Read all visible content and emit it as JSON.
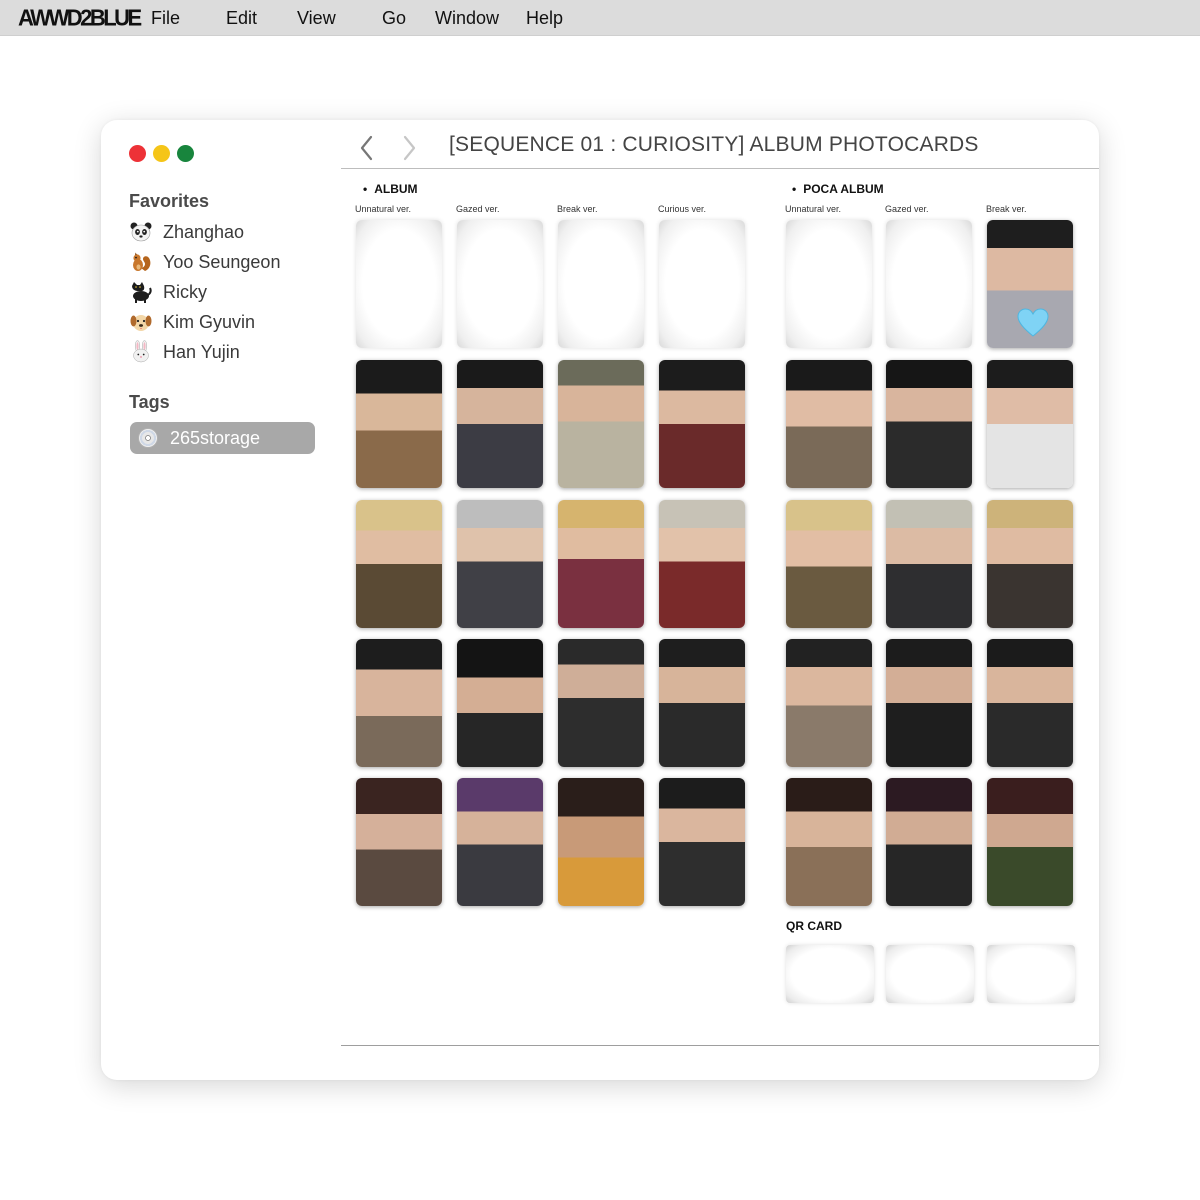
{
  "menubar": {
    "logo": "AWWD2BLUE",
    "items": [
      "File",
      "Edit",
      "View",
      "Go",
      "Window",
      "Help"
    ]
  },
  "window": {
    "title": "[SEQUENCE 01 : CURIOSITY] ALBUM PHOTOCARDS",
    "traffic_colors": [
      "#ed3237",
      "#f5c518",
      "#18853d"
    ]
  },
  "sidebar": {
    "favorites_heading": "Favorites",
    "favorites": [
      {
        "label": "Zhanghao",
        "icon": "panda-icon"
      },
      {
        "label": "Yoo Seungeon",
        "icon": "squirrel-icon"
      },
      {
        "label": "Ricky",
        "icon": "black-cat-icon"
      },
      {
        "label": "Kim Gyuvin",
        "icon": "dog-icon"
      },
      {
        "label": "Han Yujin",
        "icon": "rabbit-icon"
      }
    ],
    "tags_heading": "Tags",
    "tags": [
      {
        "label": "265storage",
        "icon": "cd-icon"
      }
    ]
  },
  "album": {
    "heading": "ALBUM",
    "columns": [
      "Unnatural ver.",
      "Gazed ver.",
      "Break ver.",
      "Curious ver."
    ]
  },
  "poca_album": {
    "heading": "POCA ALBUM",
    "columns": [
      "Unnatural ver.",
      "Gazed ver.",
      "Break ver."
    ]
  },
  "qr_card": {
    "heading": "QR CARD"
  },
  "colors": {
    "menubar_bg": "#dcdcdc",
    "tag_selected_bg": "#a8a8a8",
    "heart": "#7fd3f5"
  }
}
